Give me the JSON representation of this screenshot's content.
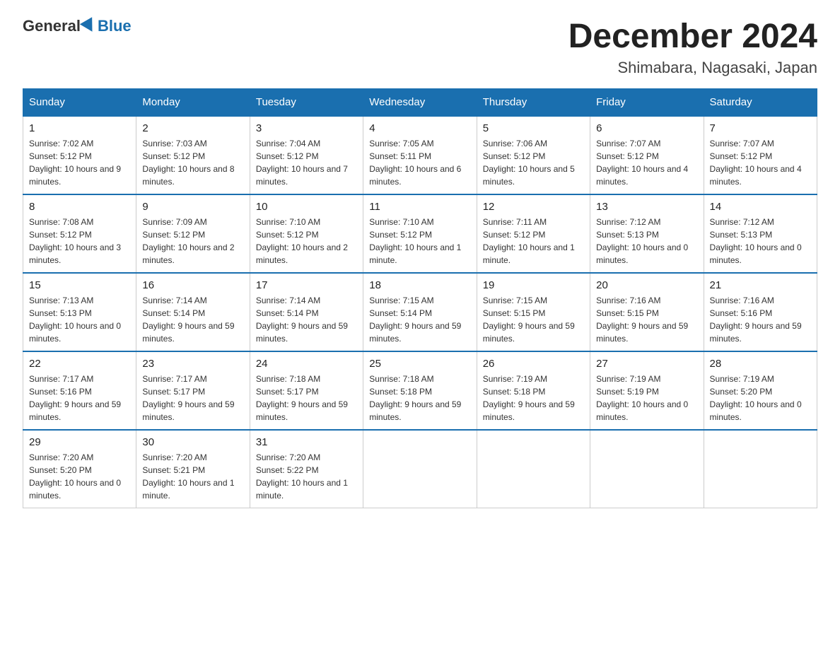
{
  "header": {
    "logo_general": "General",
    "logo_blue": "Blue",
    "month_title": "December 2024",
    "location": "Shimabara, Nagasaki, Japan"
  },
  "days_of_week": [
    "Sunday",
    "Monday",
    "Tuesday",
    "Wednesday",
    "Thursday",
    "Friday",
    "Saturday"
  ],
  "weeks": [
    [
      {
        "day": "1",
        "sunrise": "7:02 AM",
        "sunset": "5:12 PM",
        "daylight": "10 hours and 9 minutes."
      },
      {
        "day": "2",
        "sunrise": "7:03 AM",
        "sunset": "5:12 PM",
        "daylight": "10 hours and 8 minutes."
      },
      {
        "day": "3",
        "sunrise": "7:04 AM",
        "sunset": "5:12 PM",
        "daylight": "10 hours and 7 minutes."
      },
      {
        "day": "4",
        "sunrise": "7:05 AM",
        "sunset": "5:11 PM",
        "daylight": "10 hours and 6 minutes."
      },
      {
        "day": "5",
        "sunrise": "7:06 AM",
        "sunset": "5:12 PM",
        "daylight": "10 hours and 5 minutes."
      },
      {
        "day": "6",
        "sunrise": "7:07 AM",
        "sunset": "5:12 PM",
        "daylight": "10 hours and 4 minutes."
      },
      {
        "day": "7",
        "sunrise": "7:07 AM",
        "sunset": "5:12 PM",
        "daylight": "10 hours and 4 minutes."
      }
    ],
    [
      {
        "day": "8",
        "sunrise": "7:08 AM",
        "sunset": "5:12 PM",
        "daylight": "10 hours and 3 minutes."
      },
      {
        "day": "9",
        "sunrise": "7:09 AM",
        "sunset": "5:12 PM",
        "daylight": "10 hours and 2 minutes."
      },
      {
        "day": "10",
        "sunrise": "7:10 AM",
        "sunset": "5:12 PM",
        "daylight": "10 hours and 2 minutes."
      },
      {
        "day": "11",
        "sunrise": "7:10 AM",
        "sunset": "5:12 PM",
        "daylight": "10 hours and 1 minute."
      },
      {
        "day": "12",
        "sunrise": "7:11 AM",
        "sunset": "5:12 PM",
        "daylight": "10 hours and 1 minute."
      },
      {
        "day": "13",
        "sunrise": "7:12 AM",
        "sunset": "5:13 PM",
        "daylight": "10 hours and 0 minutes."
      },
      {
        "day": "14",
        "sunrise": "7:12 AM",
        "sunset": "5:13 PM",
        "daylight": "10 hours and 0 minutes."
      }
    ],
    [
      {
        "day": "15",
        "sunrise": "7:13 AM",
        "sunset": "5:13 PM",
        "daylight": "10 hours and 0 minutes."
      },
      {
        "day": "16",
        "sunrise": "7:14 AM",
        "sunset": "5:14 PM",
        "daylight": "9 hours and 59 minutes."
      },
      {
        "day": "17",
        "sunrise": "7:14 AM",
        "sunset": "5:14 PM",
        "daylight": "9 hours and 59 minutes."
      },
      {
        "day": "18",
        "sunrise": "7:15 AM",
        "sunset": "5:14 PM",
        "daylight": "9 hours and 59 minutes."
      },
      {
        "day": "19",
        "sunrise": "7:15 AM",
        "sunset": "5:15 PM",
        "daylight": "9 hours and 59 minutes."
      },
      {
        "day": "20",
        "sunrise": "7:16 AM",
        "sunset": "5:15 PM",
        "daylight": "9 hours and 59 minutes."
      },
      {
        "day": "21",
        "sunrise": "7:16 AM",
        "sunset": "5:16 PM",
        "daylight": "9 hours and 59 minutes."
      }
    ],
    [
      {
        "day": "22",
        "sunrise": "7:17 AM",
        "sunset": "5:16 PM",
        "daylight": "9 hours and 59 minutes."
      },
      {
        "day": "23",
        "sunrise": "7:17 AM",
        "sunset": "5:17 PM",
        "daylight": "9 hours and 59 minutes."
      },
      {
        "day": "24",
        "sunrise": "7:18 AM",
        "sunset": "5:17 PM",
        "daylight": "9 hours and 59 minutes."
      },
      {
        "day": "25",
        "sunrise": "7:18 AM",
        "sunset": "5:18 PM",
        "daylight": "9 hours and 59 minutes."
      },
      {
        "day": "26",
        "sunrise": "7:19 AM",
        "sunset": "5:18 PM",
        "daylight": "9 hours and 59 minutes."
      },
      {
        "day": "27",
        "sunrise": "7:19 AM",
        "sunset": "5:19 PM",
        "daylight": "10 hours and 0 minutes."
      },
      {
        "day": "28",
        "sunrise": "7:19 AM",
        "sunset": "5:20 PM",
        "daylight": "10 hours and 0 minutes."
      }
    ],
    [
      {
        "day": "29",
        "sunrise": "7:20 AM",
        "sunset": "5:20 PM",
        "daylight": "10 hours and 0 minutes."
      },
      {
        "day": "30",
        "sunrise": "7:20 AM",
        "sunset": "5:21 PM",
        "daylight": "10 hours and 1 minute."
      },
      {
        "day": "31",
        "sunrise": "7:20 AM",
        "sunset": "5:22 PM",
        "daylight": "10 hours and 1 minute."
      },
      null,
      null,
      null,
      null
    ]
  ]
}
